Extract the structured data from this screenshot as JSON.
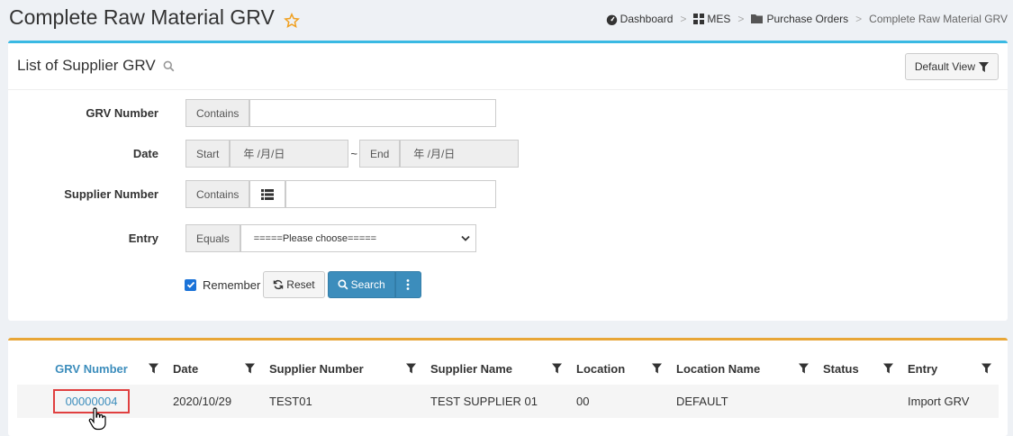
{
  "page": {
    "title": "Complete Raw Material GRV"
  },
  "breadcrumb": [
    {
      "label": "Dashboard",
      "icon": "dashboard-icon"
    },
    {
      "label": "MES",
      "icon": "grid-icon"
    },
    {
      "label": "Purchase Orders",
      "icon": "folder-icon"
    },
    {
      "label": "Complete Raw Material GRV"
    }
  ],
  "search_panel": {
    "title": "List of Supplier GRV",
    "default_view": "Default View",
    "fields": {
      "grv_number": {
        "label": "GRV Number",
        "op": "Contains",
        "value": ""
      },
      "date": {
        "label": "Date",
        "start_addon": "Start",
        "start_placeholder": "年 /月/日",
        "separator": "~",
        "end_addon": "End",
        "end_placeholder": "年 /月/日"
      },
      "supplier_number": {
        "label": "Supplier Number",
        "op": "Contains",
        "value": ""
      },
      "entry": {
        "label": "Entry",
        "op": "Equals",
        "selected": "=====Please choose====="
      }
    },
    "remember_label": "Remember",
    "remember_checked": true,
    "reset_label": "Reset",
    "search_label": "Search"
  },
  "table": {
    "columns": [
      "GRV Number",
      "Date",
      "Supplier Number",
      "Supplier Name",
      "Location",
      "Location Name",
      "Status",
      "Entry"
    ],
    "rows": [
      {
        "grv_number": "00000004",
        "date": "2020/10/29",
        "supplier_number": "TEST01",
        "supplier_name": "TEST SUPPLIER 01",
        "location": "00",
        "location_name": "DEFAULT",
        "status": "",
        "entry": "Import GRV"
      }
    ]
  },
  "colors": {
    "accent": "#3c8dbc",
    "info_border": "#3ab9e3",
    "warning_border": "#e8a637",
    "highlight": "#e04040"
  }
}
